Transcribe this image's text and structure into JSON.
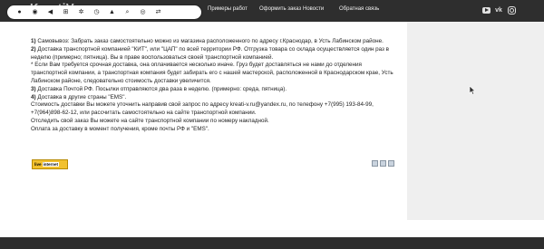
{
  "header": {
    "logo": "KreatiV",
    "nav": [
      {
        "label": "Примеры работ"
      },
      {
        "label": "Оформить заказ"
      },
      {
        "label": "Новости"
      },
      {
        "label": "Обратная связь"
      }
    ],
    "social": [
      "youtube-icon",
      "vk-icon",
      "instagram-icon"
    ]
  },
  "toolbar": {
    "icons": [
      "circle-icon",
      "eye-icon",
      "back-icon",
      "plus-square-icon",
      "gear-icon",
      "clock-icon",
      "bell-icon",
      "search-icon",
      "eye-slash-icon",
      "share-icon"
    ]
  },
  "content": {
    "p1_num": "1)",
    "p1_text": " Самовывоз: Забрать заказ самостоятельно можно из магазина расположенного по адресу  г.Краснодар, в Усть Лабинском районе.",
    "p2_num": "2)",
    "p2_text": " Доставка транспортной компанией \"КИТ\", или \"ЦАП\" по всей территории РФ. Отгрузка товара со склада осуществляется один раз в неделю (примерно; пятница). Вы в праве воспользоваться своей  транспортной компанией.",
    "p3": "* Если Вам требуется срочная доставка, она оплачивается несколько иначе. Груз будет доставляться не нами до отделения транспортной компании, а транспортная компания будет забирать его с нашей мастерской, расположенной в Краснодарском крае, Усть Лабинском районе, следовательно стоимость доставки увеличится.",
    "p4_num": "3)",
    "p4_text": " Доставка Почтой РФ. Посылки отправляются два раза в неделю. (примерно: среда, пятница).",
    "p5_num": "4)",
    "p5_text": " Доставка в другие страны \"EMS\".",
    "p6": "Стоимость доставки Вы можете уточнить направив свой запрос по адресу kreati-v.ru@yandex.ru, по телефону +7(995) 193-84-99, +7(964)898-62-12, или рассчитать самостоятельно на сайте транспортной компании.",
    "p7": "Отследить свой заказ Вы можете на сайте транспортной компании по номеру накладной.",
    "p8": "Оплата за доставку в момент получения, кроме почты РФ и \"EMS\"."
  },
  "counter": {
    "prefix": "live",
    "label": "internet"
  },
  "colors": {
    "navbar": "#2e2e2e",
    "panel": "#efefef",
    "counter": "#f2c12e"
  }
}
